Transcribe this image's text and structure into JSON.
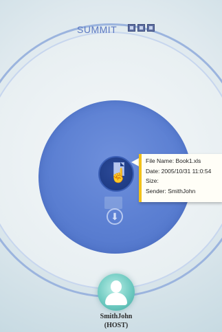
{
  "app": {
    "title": "SUMMIT",
    "window_controls": [
      "minimize-icon",
      "maximize-icon",
      "close-icon"
    ]
  },
  "colors": {
    "disk_blue": "#5b7fd2",
    "node_blue": "#1f3c86",
    "tooltip_accent": "#f2c119",
    "avatar_teal": "#6bc8bf"
  },
  "file_tooltip": {
    "file_name": "File Name: Book1.xls",
    "date": "Date: 2005/10/31 11:0:54",
    "size": "Size:",
    "sender": "Sender: SmithJohn"
  },
  "host": {
    "name": "SmithJohn",
    "role": "(HOST)"
  }
}
